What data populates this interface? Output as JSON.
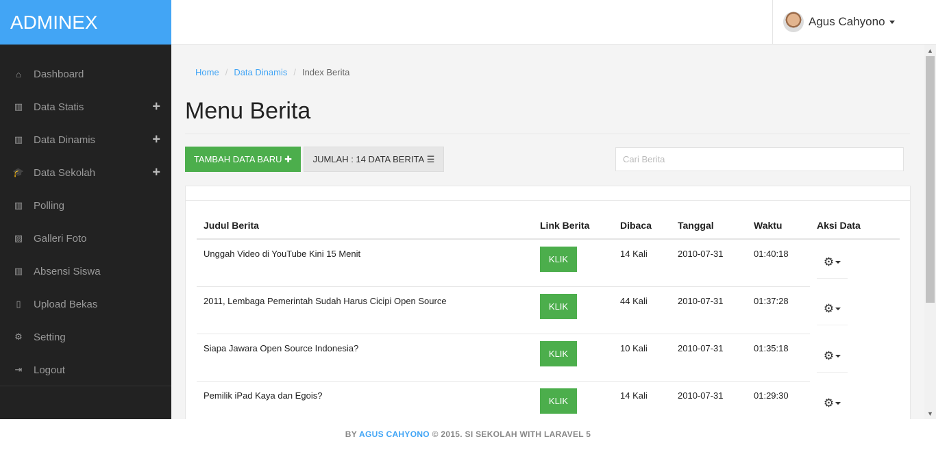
{
  "brand": "ADMINEX",
  "user": {
    "name": "Agus Cahyono"
  },
  "sidebar": {
    "items": [
      {
        "label": "Dashboard",
        "icon": "home-icon",
        "glyph": "⌂",
        "expandable": false
      },
      {
        "label": "Data Statis",
        "icon": "bar-chart-icon",
        "glyph": "▥",
        "expandable": true
      },
      {
        "label": "Data Dinamis",
        "icon": "bar-chart-icon",
        "glyph": "▥",
        "expandable": true
      },
      {
        "label": "Data Sekolah",
        "icon": "graduation-cap-icon",
        "glyph": "🎓",
        "expandable": true
      },
      {
        "label": "Polling",
        "icon": "bar-chart-icon",
        "glyph": "▥",
        "expandable": false
      },
      {
        "label": "Galleri Foto",
        "icon": "picture-file-icon",
        "glyph": "▨",
        "expandable": false
      },
      {
        "label": "Absensi Siswa",
        "icon": "bar-chart-icon",
        "glyph": "▥",
        "expandable": false
      },
      {
        "label": "Upload Bekas",
        "icon": "file-icon",
        "glyph": "▯",
        "expandable": false
      },
      {
        "label": "Setting",
        "icon": "gear-icon",
        "glyph": "⚙",
        "expandable": false
      },
      {
        "label": "Logout",
        "icon": "sign-out-icon",
        "glyph": "⇥",
        "expandable": false
      }
    ],
    "plus_glyph": "+"
  },
  "breadcrumb": [
    "Home",
    "Data Dinamis",
    "Index Berita"
  ],
  "page_title": "Menu Berita",
  "toolbar": {
    "add_label": "TAMBAH DATA BARU",
    "add_icon_glyph": "✚",
    "count_label": "JUMLAH : 14 DATA BERITA",
    "count_icon_glyph": "☰",
    "search_placeholder": "Cari Berita"
  },
  "table": {
    "headers": [
      "Judul Berita",
      "Link Berita",
      "Dibaca",
      "Tanggal",
      "Waktu",
      "Aksi Data"
    ],
    "link_label": "KLIK",
    "gear_glyph": "⚙",
    "rows": [
      {
        "title": "Unggah Video di YouTube Kini 15 Menit",
        "reads": "14 Kali",
        "date": "2010-07-31",
        "time": "01:40:18"
      },
      {
        "title": "2011, Lembaga Pemerintah Sudah Harus Cicipi Open Source",
        "reads": "44 Kali",
        "date": "2010-07-31",
        "time": "01:37:28"
      },
      {
        "title": "Siapa Jawara Open Source Indonesia?",
        "reads": "10 Kali",
        "date": "2010-07-31",
        "time": "01:35:18"
      },
      {
        "title": "Pemilik iPad Kaya dan Egois?",
        "reads": "14 Kali",
        "date": "2010-07-31",
        "time": "01:29:30"
      }
    ]
  },
  "scrollbar": {
    "up_glyph": "▲",
    "down_glyph": "▼"
  },
  "footer": {
    "prefix": "BY",
    "author": "AGUS CAHYONO",
    "suffix": "© 2015.  SI SEKOLAH WITH LARAVEL 5"
  },
  "colors": {
    "brand": "#42a5f5",
    "sidebar": "#222222",
    "success": "#4cae4c",
    "link": "#42a5f5"
  }
}
